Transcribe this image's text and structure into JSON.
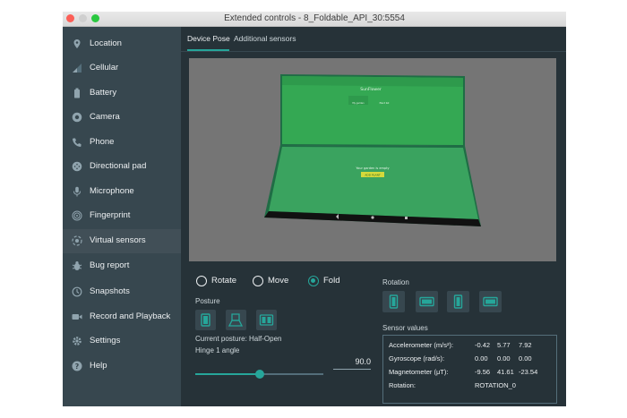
{
  "window": {
    "title": "Extended controls - 8_Foldable_API_30:5554"
  },
  "colors": {
    "accent": "#26a69a",
    "sidebar_bg": "#37474f",
    "main_bg": "#263238",
    "screen_green": "#34a853"
  },
  "sidebar": {
    "items": [
      {
        "label": "Location",
        "icon": "location-pin-icon"
      },
      {
        "label": "Cellular",
        "icon": "signal-icon"
      },
      {
        "label": "Battery",
        "icon": "battery-icon"
      },
      {
        "label": "Camera",
        "icon": "camera-icon"
      },
      {
        "label": "Phone",
        "icon": "phone-icon"
      },
      {
        "label": "Directional pad",
        "icon": "dpad-icon"
      },
      {
        "label": "Microphone",
        "icon": "microphone-icon"
      },
      {
        "label": "Fingerprint",
        "icon": "fingerprint-icon"
      },
      {
        "label": "Virtual sensors",
        "icon": "sensors-icon",
        "active": true
      },
      {
        "label": "Bug report",
        "icon": "bug-icon"
      },
      {
        "label": "Snapshots",
        "icon": "history-icon"
      },
      {
        "label": "Record and Playback",
        "icon": "video-icon"
      },
      {
        "label": "Settings",
        "icon": "gear-icon"
      },
      {
        "label": "Help",
        "icon": "help-icon"
      }
    ]
  },
  "tabs": [
    {
      "label": "Device Pose",
      "active": true
    },
    {
      "label": "Additional sensors",
      "active": false
    }
  ],
  "mode": {
    "options": [
      {
        "label": "Rotate",
        "selected": false
      },
      {
        "label": "Move",
        "selected": false
      },
      {
        "label": "Fold",
        "selected": true
      }
    ]
  },
  "posture": {
    "label": "Posture",
    "current": "Current posture: Half-Open",
    "hinge_label": "Hinge 1 angle",
    "hinge_value": "90.0",
    "hinge_fraction": 0.5
  },
  "rotation": {
    "label": "Rotation"
  },
  "sensors": {
    "label": "Sensor values",
    "rows": [
      {
        "name": "Accelerometer (m/s²):",
        "values": [
          "-0.42",
          "5.77",
          "7.92"
        ]
      },
      {
        "name": "Gyroscope (rad/s):",
        "values": [
          "0.00",
          "0.00",
          "0.00"
        ]
      },
      {
        "name": "Magnetometer (μT):",
        "values": [
          "-9.56",
          "41.61",
          "-23.54"
        ]
      },
      {
        "name": "Rotation:",
        "values": [
          "ROTATION_0"
        ]
      }
    ]
  },
  "device_screen": {
    "app_title": "SunFlower",
    "tab_left": "My garden",
    "tab_right": "Plant list",
    "empty_text": "Your garden is empty",
    "add_button": "ADD PLANT"
  }
}
